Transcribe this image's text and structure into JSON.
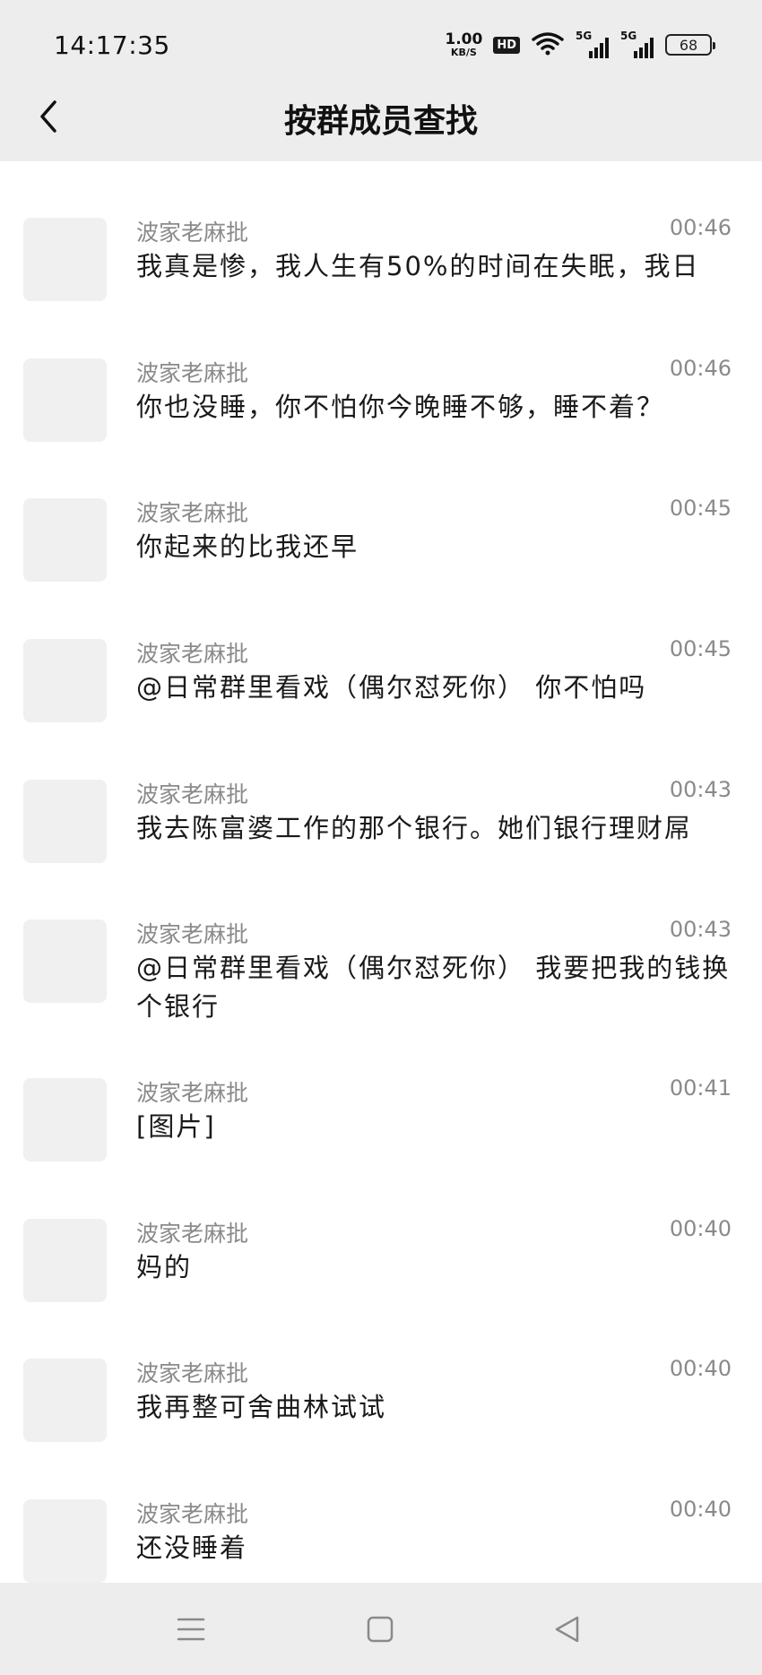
{
  "status_bar": {
    "time": "14:17:35",
    "net_speed_value": "1.00",
    "net_speed_unit": "KB/S",
    "hd_badge": "HD",
    "sim1_label": "5G",
    "sim2_label": "5G",
    "battery": "68"
  },
  "header": {
    "title": "按群成员查找",
    "back_icon": "chevron-left-icon"
  },
  "messages": [
    {
      "sender": "波家老麻批",
      "time": "00:46",
      "text": "我真是惨，我人生有50%的时间在失眠，我日"
    },
    {
      "sender": "波家老麻批",
      "time": "00:46",
      "text": "你也没睡，你不怕你今晚睡不够，睡不着？"
    },
    {
      "sender": "波家老麻批",
      "time": "00:45",
      "text": "你起来的比我还早"
    },
    {
      "sender": "波家老麻批",
      "time": "00:45",
      "text": "@日常群里看戏（偶尔怼死你） 你不怕吗"
    },
    {
      "sender": "波家老麻批",
      "time": "00:43",
      "text": "我去陈富婆工作的那个银行。她们银行理财屌"
    },
    {
      "sender": "波家老麻批",
      "time": "00:43",
      "text": "@日常群里看戏（偶尔怼死你） 我要把我的钱换个银行"
    },
    {
      "sender": "波家老麻批",
      "time": "00:41",
      "text": "[图片]"
    },
    {
      "sender": "波家老麻批",
      "time": "00:40",
      "text": "妈的"
    },
    {
      "sender": "波家老麻批",
      "time": "00:40",
      "text": "我再整可舍曲林试试"
    },
    {
      "sender": "波家老麻批",
      "time": "00:40",
      "text": "还没睡着"
    }
  ],
  "bottom_nav": {
    "menu_icon": "menu-icon",
    "home_icon": "square-home-icon",
    "back_icon": "triangle-back-icon"
  },
  "colors": {
    "header_bg": "#ededed",
    "list_bg": "#ffffff",
    "secondary_text": "#8a8a8a",
    "primary_text": "#1a1a1a"
  }
}
